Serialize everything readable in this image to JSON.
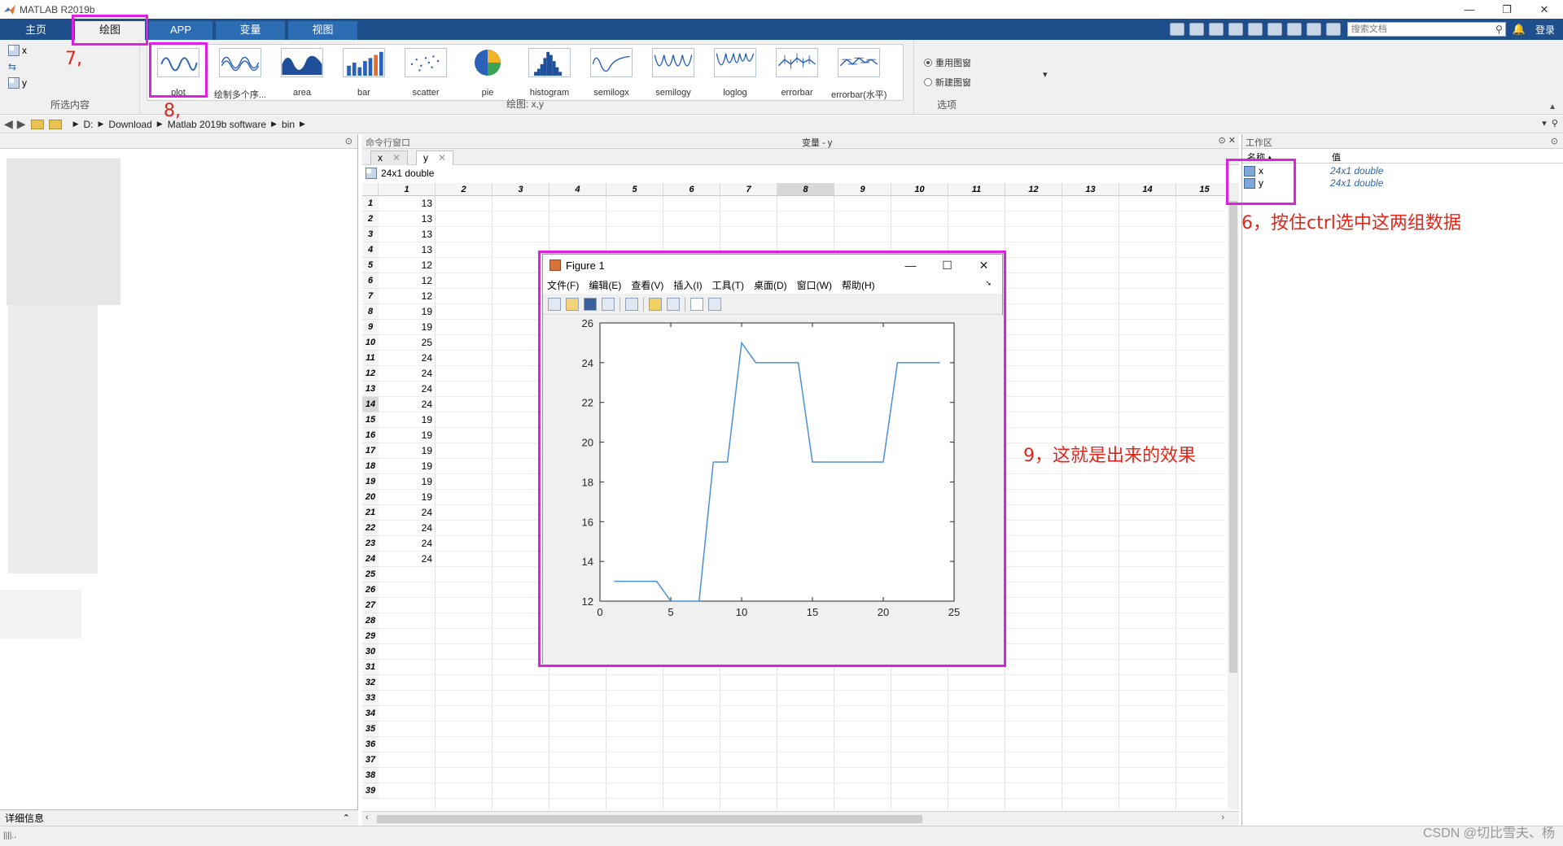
{
  "app": {
    "title": "MATLAB R2019b",
    "window_controls": [
      "—",
      "❐",
      "✕"
    ]
  },
  "tabs": [
    {
      "label": "主页"
    },
    {
      "label": "绘图"
    },
    {
      "label": "APP"
    },
    {
      "label": "变量"
    },
    {
      "label": "视图"
    }
  ],
  "toolbar_right": {
    "search_placeholder": "搜索文档",
    "login": "登录"
  },
  "ribbon": {
    "selection": {
      "items": [
        "x",
        "y"
      ],
      "label": "所选内容"
    },
    "gallery": {
      "label": "绘图: x,y",
      "items": [
        "plot",
        "绘制多个序...",
        "area",
        "bar",
        "scatter",
        "pie",
        "histogram",
        "semilogx",
        "semilogy",
        "loglog",
        "errorbar",
        "errorbar(水平)"
      ]
    },
    "options": {
      "label": "选项",
      "radio1": "重用图窗",
      "radio2": "新建图窗"
    }
  },
  "address": {
    "drive": "D:",
    "path": [
      "Download",
      "Matlab 2019b software",
      "bin"
    ]
  },
  "left_panel": {
    "details_label": "详细信息"
  },
  "middle_panel": {
    "command_window_label": "命令行窗口",
    "variables_title": "变量 - y",
    "var_tabs": [
      "x",
      "y"
    ],
    "var_info": "24x1 double",
    "col_headers": [
      "1",
      "2",
      "3",
      "4",
      "5",
      "6",
      "7",
      "8",
      "9",
      "10",
      "11",
      "12",
      "13",
      "14",
      "15"
    ],
    "row_count": 39,
    "y_values": [
      13,
      13,
      13,
      13,
      12,
      12,
      12,
      19,
      19,
      25,
      24,
      24,
      24,
      24,
      19,
      19,
      19,
      19,
      19,
      19,
      24,
      24,
      24,
      24
    ]
  },
  "workspace": {
    "title": "工作区",
    "col_name": "名称 ▴",
    "col_value": "值",
    "vars": [
      {
        "name": "x",
        "value": "24x1 double"
      },
      {
        "name": "y",
        "value": "24x1 double"
      }
    ]
  },
  "figure": {
    "title": "Figure 1",
    "menu": [
      "文件(F)",
      "编辑(E)",
      "查看(V)",
      "插入(I)",
      "工具(T)",
      "桌面(D)",
      "窗口(W)",
      "帮助(H)"
    ]
  },
  "chart_data": {
    "type": "line",
    "x": [
      1,
      2,
      3,
      4,
      5,
      6,
      7,
      8,
      9,
      10,
      11,
      12,
      13,
      14,
      15,
      16,
      17,
      18,
      19,
      20,
      21,
      22,
      23,
      24
    ],
    "series": [
      {
        "values": [
          13,
          13,
          13,
          13,
          12,
          12,
          12,
          19,
          19,
          25,
          24,
          24,
          24,
          24,
          19,
          19,
          19,
          19,
          19,
          19,
          24,
          24,
          24,
          24
        ]
      }
    ],
    "xlim": [
      0,
      25
    ],
    "ylim": [
      12,
      26
    ],
    "xticks": [
      "0",
      "5",
      "10",
      "15",
      "20",
      "25"
    ],
    "yticks": [
      "12",
      "14",
      "16",
      "18",
      "20",
      "22",
      "24",
      "26"
    ],
    "title": "",
    "xlabel": "",
    "ylabel": "",
    "line_color": "#4a90d9",
    "grid": false
  },
  "annotations": {
    "a7": "7,",
    "a8": "8,",
    "a6": "6，按住ctrl选中这两组数据",
    "a9": "9，这就是出来的效果"
  },
  "watermark": "CSDN @切比雪夫、杨",
  "colors": {
    "tab_bar": "#1e4f8a",
    "annotation": "#e0261a",
    "highlight_box": "#e020e0"
  }
}
